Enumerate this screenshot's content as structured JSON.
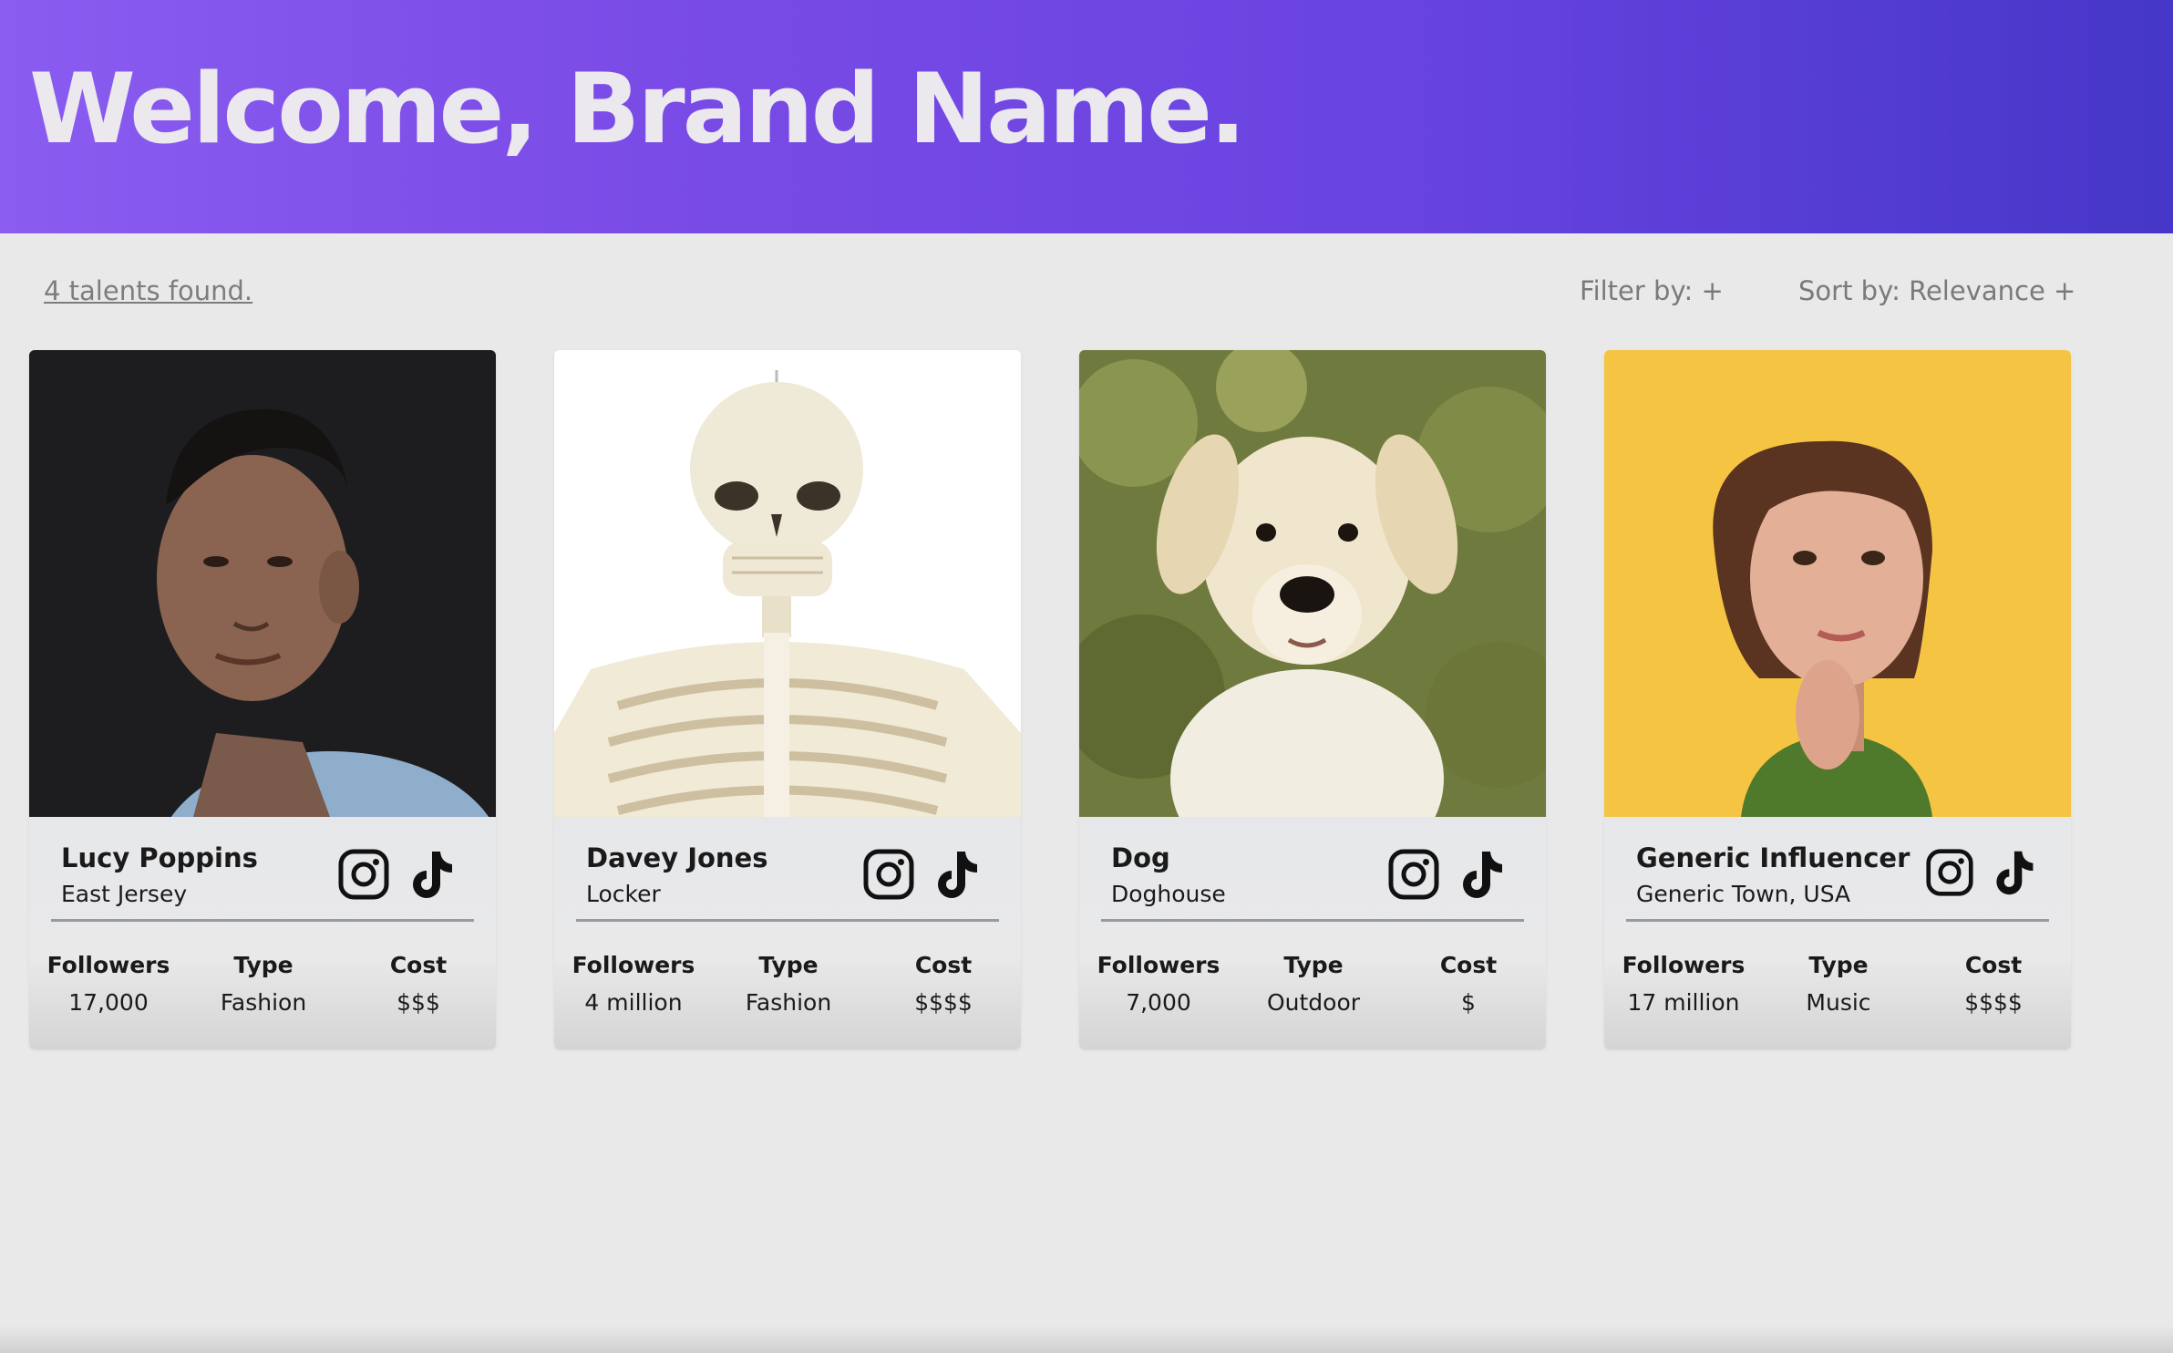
{
  "header": {
    "title": "Welcome, Brand Name."
  },
  "toolbar": {
    "results": "4 talents found.",
    "filter_label": "Filter by: +",
    "sort_label": "Sort by: Relevance +"
  },
  "stat_labels": {
    "followers": "Followers",
    "type": "Type",
    "cost": "Cost"
  },
  "talents": [
    {
      "name": "Lucy Poppins",
      "location": "East Jersey",
      "followers": "17,000",
      "type": "Fashion",
      "cost": "$$$",
      "photo": "man-portrait"
    },
    {
      "name": "Davey Jones",
      "location": "Locker",
      "followers": "4 million",
      "type": "Fashion",
      "cost": "$$$$",
      "photo": "skeleton"
    },
    {
      "name": "Dog",
      "location": "Doghouse",
      "followers": "7,000",
      "type": "Outdoor",
      "cost": "$",
      "photo": "labrador-puppy"
    },
    {
      "name": "Generic Influencer",
      "location": "Generic Town, USA",
      "followers": "17 million",
      "type": "Music",
      "cost": "$$$$",
      "photo": "woman-portrait"
    }
  ],
  "icons": {
    "instagram": "instagram-icon",
    "tiktok": "tiktok-icon"
  },
  "colors": {
    "header_start": "#8a5cf0",
    "header_end": "#4537c8",
    "background": "#e9e9e9"
  }
}
